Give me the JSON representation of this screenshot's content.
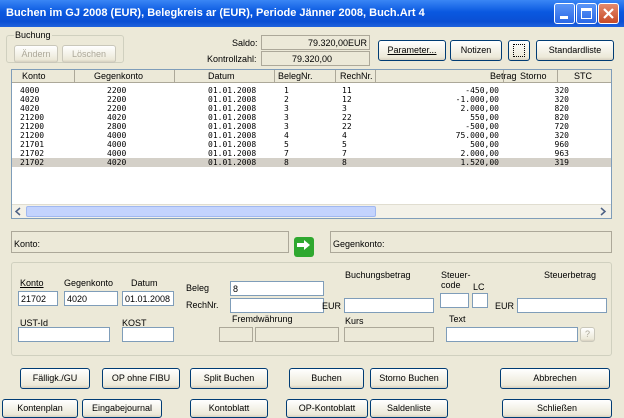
{
  "window": {
    "title": "Buchen im GJ 2008 (EUR), Belegkreis ar (EUR), Periode Jänner 2008, Buch.Art 4"
  },
  "buchung_group": {
    "label": "Buchung",
    "aendern": "Ändern",
    "loeschen": "Löschen"
  },
  "saldo": {
    "label": "Saldo:",
    "value": "79.320,00EUR",
    "kontrollzahl_label": "Kontrollzahl:",
    "kontrollzahl_value": "79.320,00"
  },
  "toolbar": {
    "parameter": "Parameter...",
    "notizen": "Notizen",
    "standardliste": "Standardliste"
  },
  "table": {
    "columns": [
      "Konto",
      "Gegenkonto",
      "Datum",
      "BelegNr.",
      "RechNr.",
      "Betrag",
      "Storno",
      "STC"
    ],
    "rows": [
      {
        "konto": "4000",
        "gegenkonto": "2200",
        "datum": "01.01.2008",
        "beleg": "1",
        "rech": "11",
        "betrag": "-450,00",
        "storno": "",
        "stc": "320"
      },
      {
        "konto": "4020",
        "gegenkonto": "2200",
        "datum": "01.01.2008",
        "beleg": "2",
        "rech": "12",
        "betrag": "-1.000,00",
        "storno": "",
        "stc": "320"
      },
      {
        "konto": "4020",
        "gegenkonto": "2200",
        "datum": "01.01.2008",
        "beleg": "3",
        "rech": "3",
        "betrag": "2.000,00",
        "storno": "",
        "stc": "820"
      },
      {
        "konto": "21200",
        "gegenkonto": "4020",
        "datum": "01.01.2008",
        "beleg": "3",
        "rech": "22",
        "betrag": "550,00",
        "storno": "",
        "stc": "820"
      },
      {
        "konto": "21200",
        "gegenkonto": "2800",
        "datum": "01.01.2008",
        "beleg": "3",
        "rech": "22",
        "betrag": "-500,00",
        "storno": "",
        "stc": "720"
      },
      {
        "konto": "21200",
        "gegenkonto": "4000",
        "datum": "01.01.2008",
        "beleg": "4",
        "rech": "4",
        "betrag": "75.000,00",
        "storno": "",
        "stc": "320"
      },
      {
        "konto": "21701",
        "gegenkonto": "4000",
        "datum": "01.01.2008",
        "beleg": "5",
        "rech": "5",
        "betrag": "500,00",
        "storno": "",
        "stc": "960"
      },
      {
        "konto": "21702",
        "gegenkonto": "4000",
        "datum": "01.01.2008",
        "beleg": "7",
        "rech": "7",
        "betrag": "2.000,00",
        "storno": "",
        "stc": "963"
      },
      {
        "konto": "21702",
        "gegenkonto": "4020",
        "datum": "01.01.2008",
        "beleg": "8",
        "rech": "8",
        "betrag": "1.520,00",
        "storno": "",
        "stc": "319"
      }
    ]
  },
  "info_bar": {
    "konto_label": "Konto:",
    "gegenkonto_label": "Gegenkonto:"
  },
  "form": {
    "konto_label": "Konto",
    "konto_value": "21702",
    "gegenkonto_label": "Gegenkonto",
    "gegenkonto_value": "4020",
    "datum_label": "Datum",
    "datum_value": "01.01.2008",
    "beleg_label": "Beleg",
    "beleg_value": "8",
    "rechnr_label": "RechNr.",
    "rechnr_value": "",
    "buchungsbetrag_label": "Buchungsbetrag",
    "eur_label": "EUR",
    "steuercode_label": "Steuer-code",
    "lc_label": "LC",
    "steuerbetrag_label": "Steuerbetrag",
    "eur2_label": "EUR",
    "ustid_label": "UST-Id",
    "kost_label": "KOST",
    "fremdwaehrung_label": "Fremdwährung",
    "kurs_label": "Kurs",
    "text_label": "Text",
    "text_button": "?"
  },
  "buttons_row1": {
    "faellig": "Fälligk./GU",
    "op_ohne_fibu": "OP ohne FIBU",
    "split": "Split Buchen",
    "buchen": "Buchen",
    "storno": "Storno Buchen",
    "abbrechen": "Abbrechen"
  },
  "buttons_row2": {
    "kontenplan": "Kontenplan",
    "eingabejournal": "Eingabejournal",
    "kontoblatt": "Kontoblatt",
    "op_kontoblatt": "OP-Kontoblatt",
    "saldenliste": "Saldenliste",
    "schliessen": "Schließen"
  },
  "colors": {
    "titlebar": "#0b4fd4",
    "window_bg": "#ece9d8",
    "selected_row": "#d4d0c8",
    "swap_icon": "#2fa82f"
  }
}
